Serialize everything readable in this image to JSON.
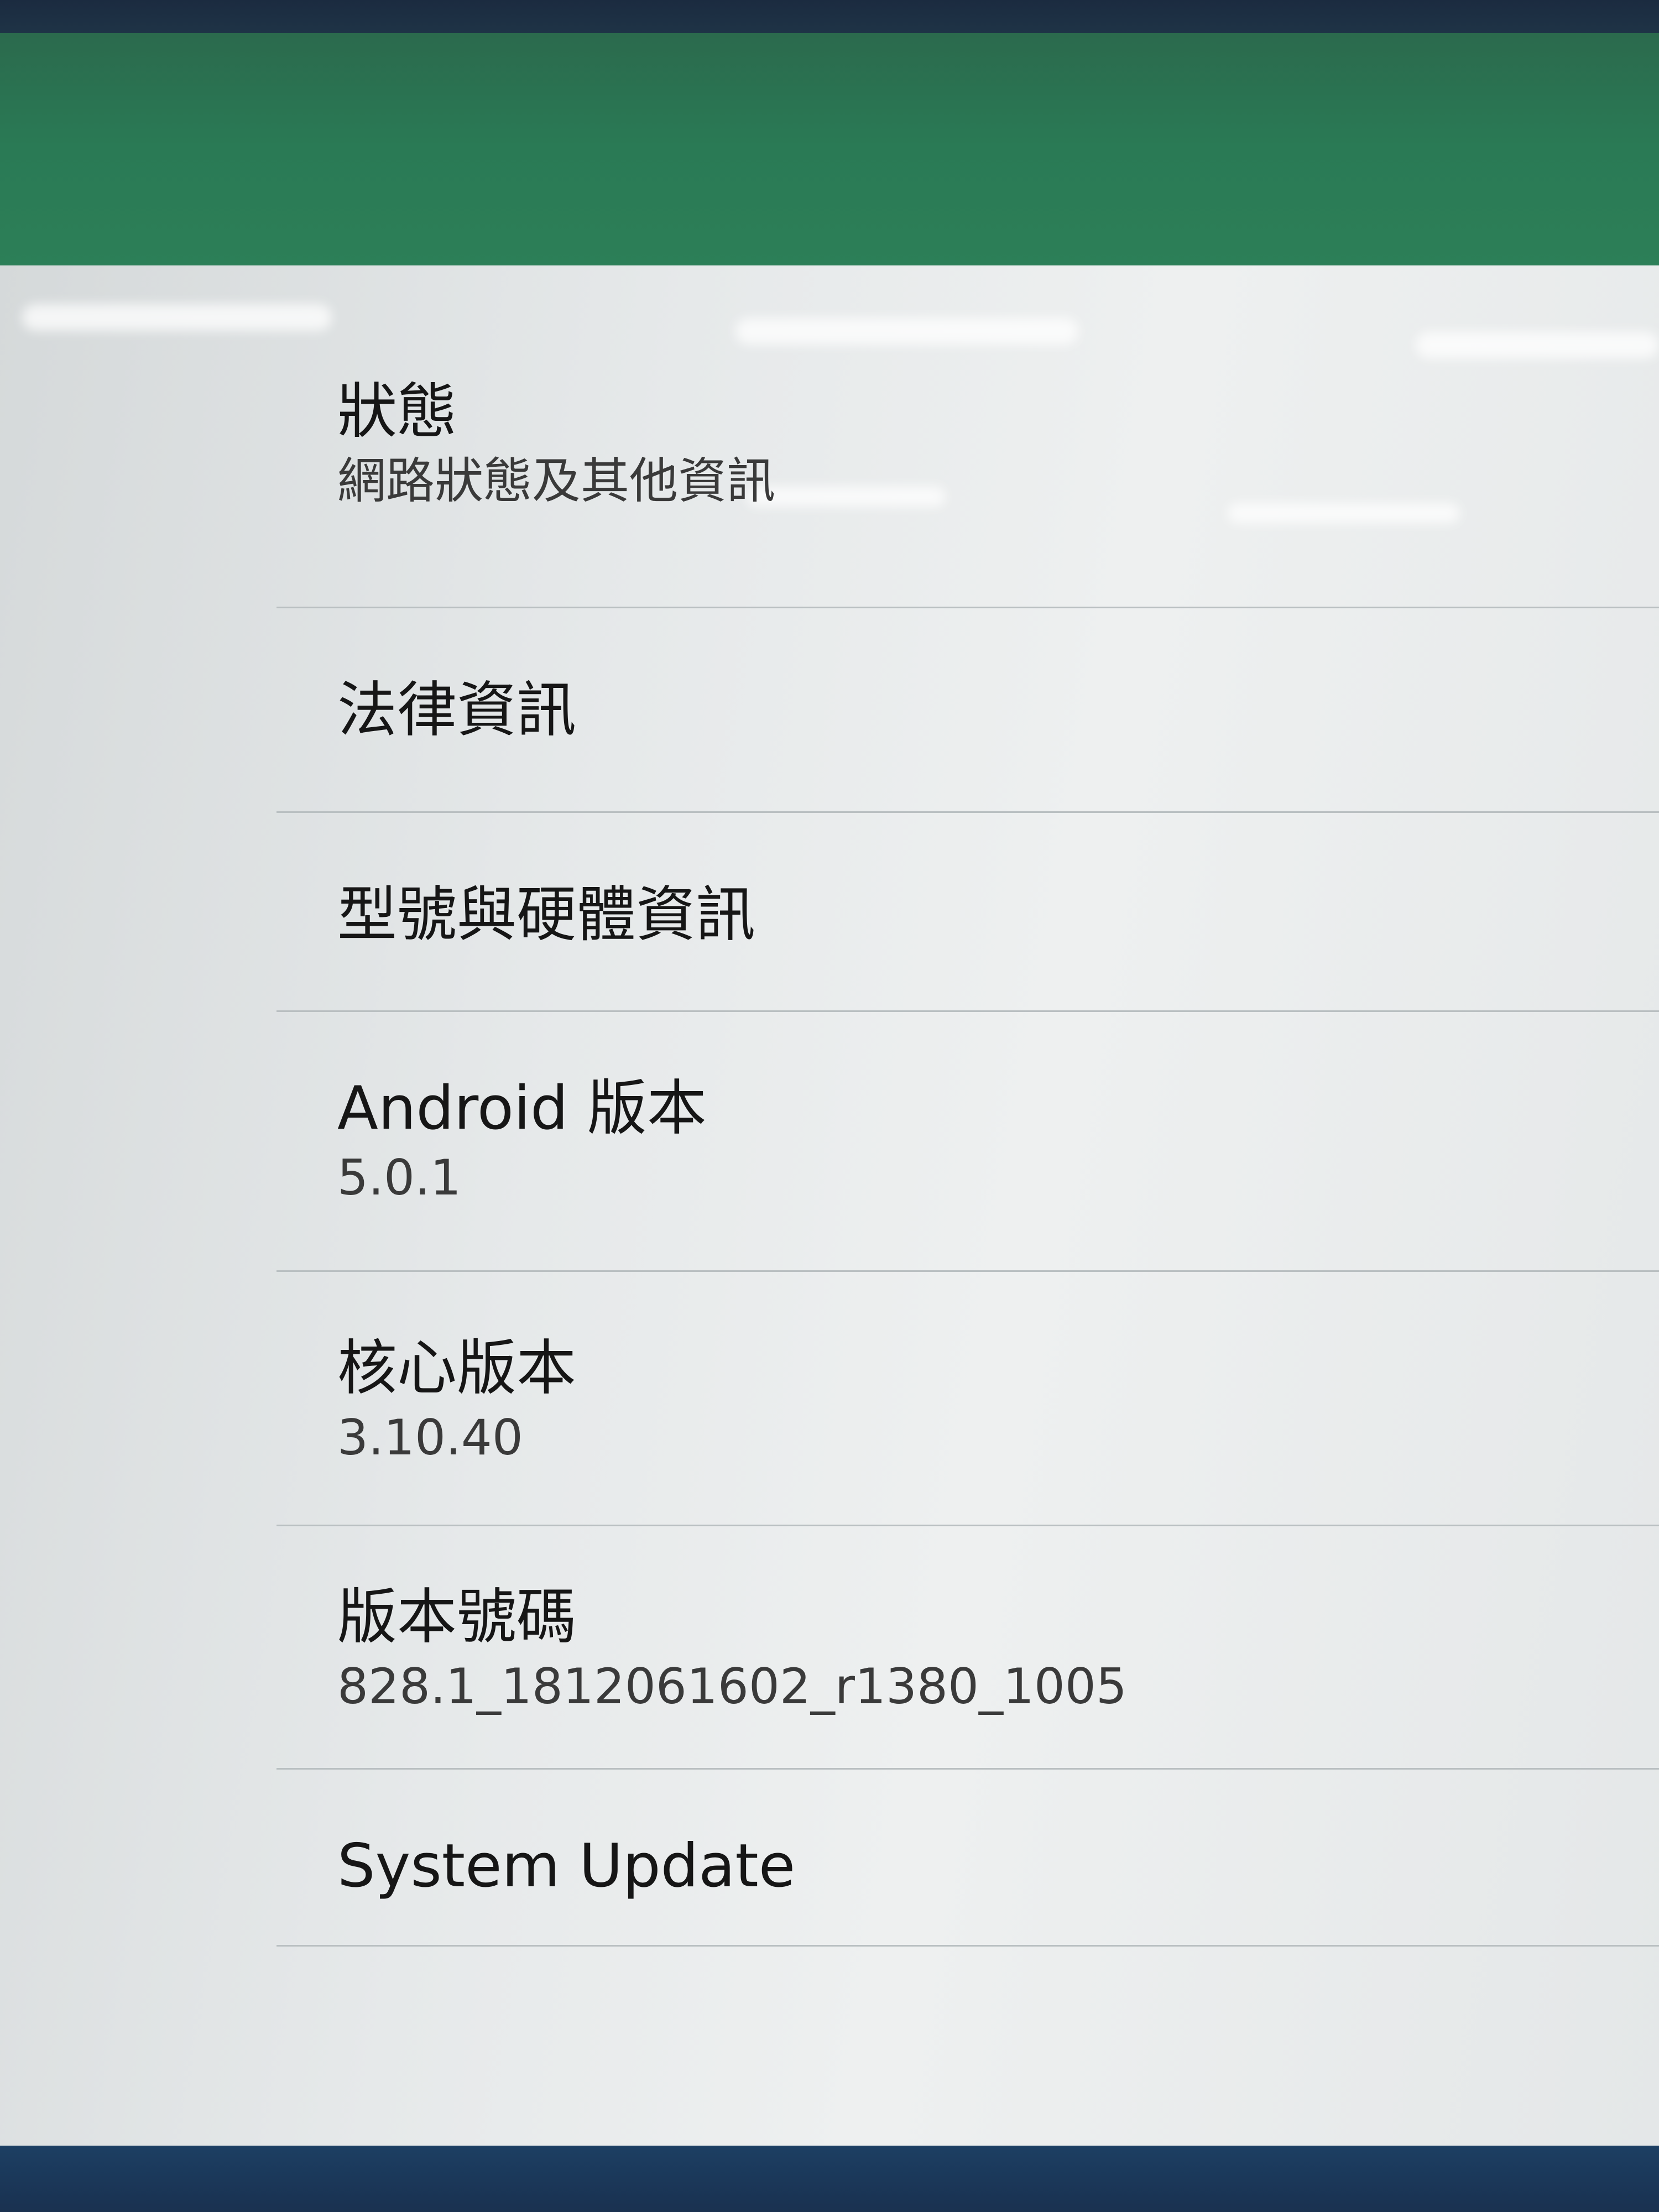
{
  "settings": {
    "items": [
      {
        "title": "狀態",
        "summary": "網路狀態及其他資訊"
      },
      {
        "title": "法律資訊"
      },
      {
        "title": "型號與硬體資訊"
      },
      {
        "title": "Android 版本",
        "summary": "5.0.1"
      },
      {
        "title": "核心版本",
        "summary": "3.10.40"
      },
      {
        "title": "版本號碼",
        "summary": "828.1_1812061602_r1380_1005"
      },
      {
        "title": "System Update"
      }
    ]
  },
  "colors": {
    "app_bar": "#2a7a55",
    "background": "#e9ecec",
    "divider": "#b9bfc1",
    "title_text": "#161616",
    "summary_text": "#3a3a3a"
  }
}
